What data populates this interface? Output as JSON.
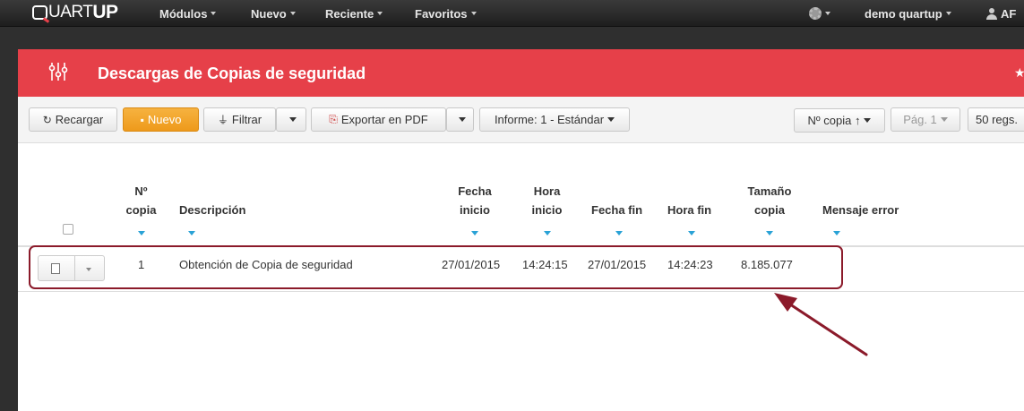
{
  "topbar": {
    "logo_q": "",
    "logo_mid": "UART",
    "logo_end": "UP",
    "menu": [
      "Módulos",
      "Nuevo",
      "Reciente",
      "Favoritos"
    ],
    "user_menu": "demo quartup",
    "user_short": "AF"
  },
  "header": {
    "title": "Descargas de Copias de seguridad"
  },
  "toolbar": {
    "reload": "Recargar",
    "new": "Nuevo",
    "filter": "Filtrar",
    "export": "Exportar en PDF",
    "report": "Informe: 1 - Estándar",
    "sort": "Nº copia ↑",
    "page": "Pág. 1",
    "per_page": "50 regs."
  },
  "table": {
    "columns": {
      "num_l1": "Nº",
      "num_l2": "copia",
      "desc": "Descripción",
      "fi_l1": "Fecha",
      "fi_l2": "inicio",
      "hi_l1": "Hora",
      "hi_l2": "inicio",
      "ff": "Fecha fin",
      "hf": "Hora fin",
      "size_l1": "Tamaño",
      "size_l2": "copia",
      "err": "Mensaje error"
    },
    "rows": [
      {
        "num": "1",
        "desc": "Obtención de Copia de seguridad",
        "fecha_inicio": "27/01/2015",
        "hora_inicio": "14:24:15",
        "fecha_fin": "27/01/2015",
        "hora_fin": "14:24:23",
        "size": "8.185.077",
        "error": ""
      }
    ]
  },
  "colors": {
    "header_red": "#e64049",
    "accent_orange": "#ee9a1b",
    "annotation": "#8b1a2a",
    "sort_blue": "#2aa2d6"
  }
}
